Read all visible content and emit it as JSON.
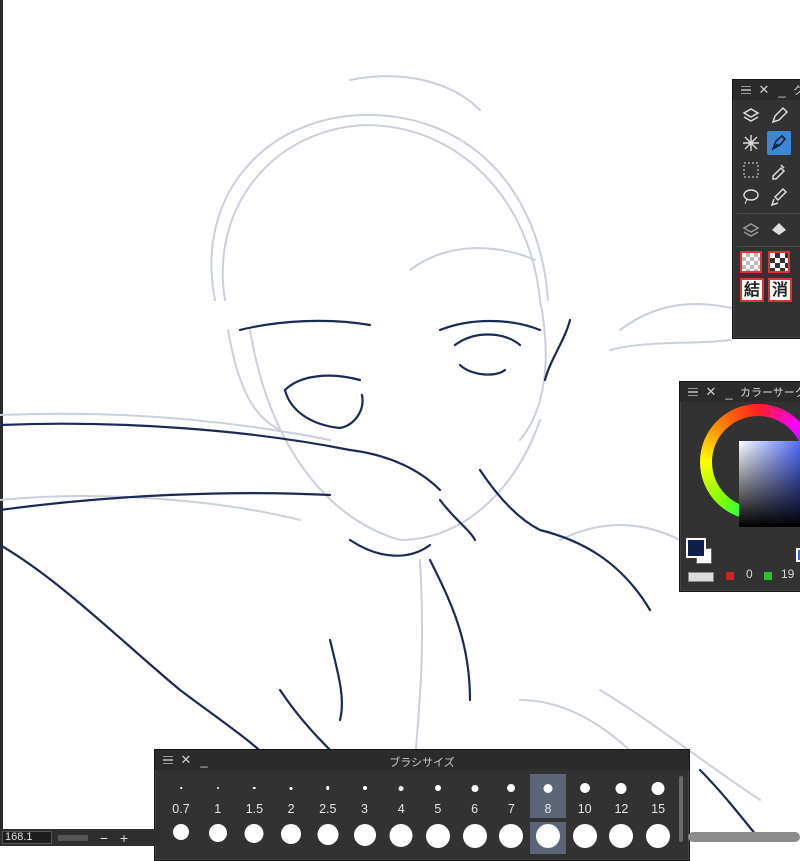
{
  "tool_panel": {
    "title": "ク",
    "kanji_buttons": [
      "結",
      "消"
    ]
  },
  "color_panel": {
    "title": "カラーサーク",
    "main_color": "#0d1f4a",
    "sub_color": "#ffffff",
    "rgb_values": [
      "0",
      "19"
    ]
  },
  "brush_panel": {
    "title": "ブラシサイズ",
    "sizes": [
      "0.7",
      "1",
      "1.5",
      "2",
      "2.5",
      "3",
      "4",
      "5",
      "6",
      "7",
      "8",
      "10",
      "12",
      "15"
    ],
    "selected": "8"
  },
  "status": {
    "zoom": "168.1",
    "zoom_out": "−",
    "zoom_in": "+"
  },
  "colors": {
    "panel_bg": "#323232",
    "active_tool": "#3d87d6",
    "line_art": "#1b2a55",
    "sketch": "#c9d0dc"
  }
}
